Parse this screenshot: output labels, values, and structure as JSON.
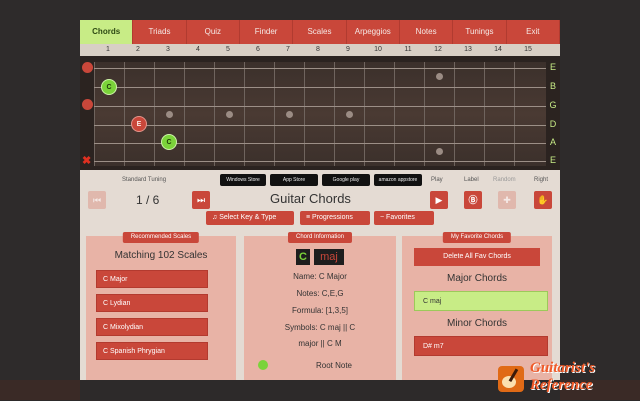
{
  "menu": {
    "tabs": [
      "Chords",
      "Triads",
      "Quiz",
      "Finder",
      "Scales",
      "Arpeggios",
      "Notes",
      "Tunings",
      "Exit"
    ],
    "active": "Chords"
  },
  "fret_numbers": [
    "1",
    "2",
    "3",
    "4",
    "5",
    "6",
    "7",
    "8",
    "9",
    "10",
    "11",
    "12",
    "13",
    "14",
    "15"
  ],
  "strings": [
    "E",
    "B",
    "G",
    "D",
    "A",
    "E"
  ],
  "fretboard_notes": [
    {
      "label": "C",
      "color": "green"
    },
    {
      "label": "E",
      "color": "red"
    },
    {
      "label": "C",
      "color": "green"
    }
  ],
  "controls": {
    "tuning_label": "Standard Tuning",
    "stores": [
      "Windows Store",
      "App Store",
      "Google play",
      "amazon appstore"
    ],
    "play_label": "Play",
    "label_label": "Label",
    "random_label": "Random",
    "right_label": "Right",
    "counter": "1 / 6",
    "page_title": "Guitar Chords",
    "pills": [
      "Select Key & Type",
      "Progressions",
      "Favorites"
    ]
  },
  "recommended": {
    "header": "Recommended Scales",
    "title": "Matching 102 Scales",
    "items": [
      "C Major",
      "C Lydian",
      "C Mixolydian",
      "C Spanish Phrygian"
    ]
  },
  "chord_info": {
    "header": "Chord Information",
    "root": "C",
    "type": "maj",
    "name": "Name: C Major",
    "notes": "Notes: C,E,G",
    "formula": "Formula: [1,3,5]",
    "symbols_1": "Symbols: C maj  ||  C",
    "symbols_2": "major  ||  C M",
    "root_note_label": "Root Note"
  },
  "favorites": {
    "header": "My Favorite Chords",
    "delete_all": "Delete All Fav Chords",
    "major_title": "Major Chords",
    "major_items": [
      "C maj"
    ],
    "minor_title": "Minor Chords",
    "minor_items": [
      "D# m7"
    ]
  },
  "logo": {
    "line1": "Guitarist's",
    "line2": "Reference"
  },
  "colors": {
    "accent": "#c9473a",
    "highlight": "#c8ec86",
    "note_green": "#7bd33a"
  }
}
